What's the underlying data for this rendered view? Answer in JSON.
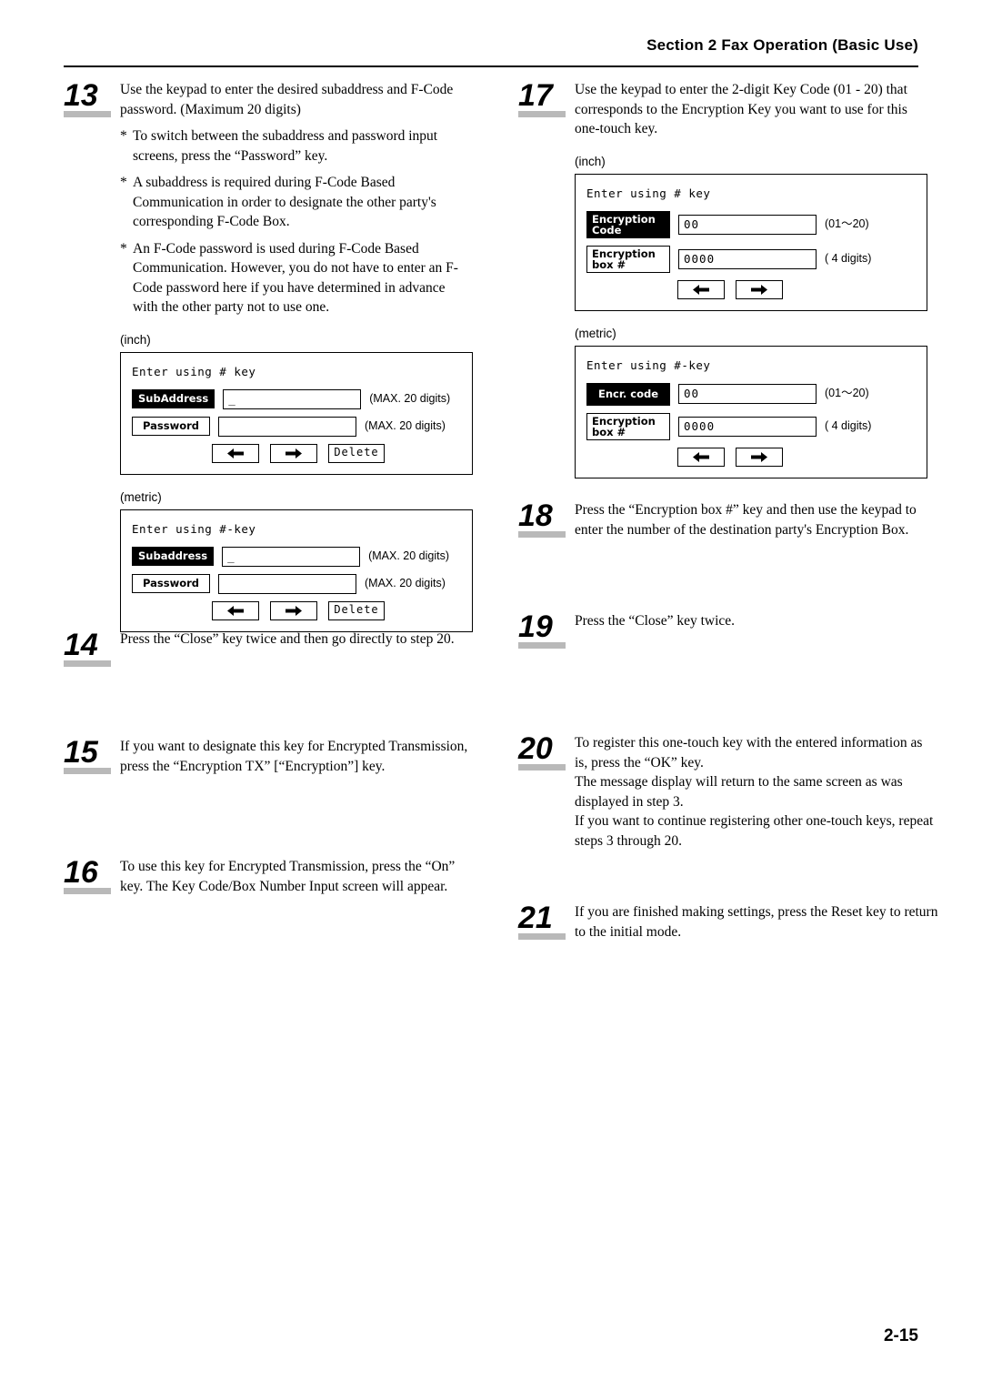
{
  "header": {
    "title": "Section 2  Fax Operation (Basic Use)"
  },
  "footer": {
    "page": "2-15"
  },
  "steps": {
    "s13": {
      "num": "13",
      "lead": "Use the keypad to enter the desired subaddress and F-Code password. (Maximum 20 digits)",
      "bullets": [
        "To switch between the subaddress and password input screens, press the “Password” key.",
        "A subaddress is required during F-Code Based Communication in order to designate the other party's corresponding F-Code Box.",
        "An F-Code password is used during F-Code Based Communication. However, you do not have to enter an F-Code password here if you have determined in advance with the other party not to use one."
      ]
    },
    "s14": {
      "num": "14",
      "lead": "Press the “Close” key twice and then go directly to step 20."
    },
    "s15": {
      "num": "15",
      "lead": "If you want to designate this key for Encrypted Transmission, press the “Encryption TX” [“Encryption”] key."
    },
    "s16": {
      "num": "16",
      "lead": "To use this key for Encrypted Transmission, press the “On” key. The Key Code/Box Number Input screen will appear."
    },
    "s17": {
      "num": "17",
      "lead": "Use the keypad to enter the 2-digit Key Code (01 - 20) that corresponds to the Encryption Key you want to use for this one-touch key."
    },
    "s18": {
      "num": "18",
      "lead": "Press the “Encryption box #” key and then use the keypad to enter the number of the destination party's Encryption Box."
    },
    "s19": {
      "num": "19",
      "lead": "Press the “Close” key twice."
    },
    "s20": {
      "num": "20",
      "lead": "To register this one-touch key with the entered information as is, press the “OK” key.",
      "line2": "The message display will return to the same screen as was displayed in step 3.",
      "line3": "If you want to continue registering other one-touch keys, repeat steps 3 through 20."
    },
    "s21": {
      "num": "21",
      "lead": "If you are finished making settings, press the Reset key to return to the initial mode."
    }
  },
  "panels": {
    "subaddress_inch": {
      "label": "(inch)",
      "title": "Enter using # key",
      "key1": "SubAddress",
      "field1_value": "_",
      "hint1": "(MAX. 20 digits)",
      "key2": "Password",
      "field2_value": "",
      "hint2": "(MAX. 20 digits)",
      "btn_left": "left-arrow",
      "btn_right": "right-arrow",
      "btn_delete": "Delete"
    },
    "subaddress_metric": {
      "label": "(metric)",
      "title": "Enter using #-key",
      "key1": "Subaddress",
      "field1_value": "_",
      "hint1": "(MAX. 20 digits)",
      "key2": "Password",
      "field2_value": "",
      "hint2": "(MAX. 20 digits)",
      "btn_left": "left-arrow",
      "btn_right": "right-arrow",
      "btn_delete": "Delete"
    },
    "encryption_inch": {
      "label": "(inch)",
      "title": "Enter using # key",
      "key1_line1": "Encryption",
      "key1_line2": "Code",
      "field1_value": "00",
      "hint1": "(01～20)",
      "key2_line1": "Encryption",
      "key2_line2": "box #",
      "field2_value": "0000",
      "hint2": "( 4 digits)",
      "btn_left": "left-arrow",
      "btn_right": "right-arrow"
    },
    "encryption_metric": {
      "label": "(metric)",
      "title": "Enter using #-key",
      "key1_line1": "Encr. code",
      "key1_line2": "",
      "field1_value": "00",
      "hint1": "(01～20)",
      "key2_line1": "Encryption",
      "key2_line2": "box #",
      "field2_value": "0000",
      "hint2": "( 4 digits)",
      "btn_left": "left-arrow",
      "btn_right": "right-arrow"
    }
  }
}
